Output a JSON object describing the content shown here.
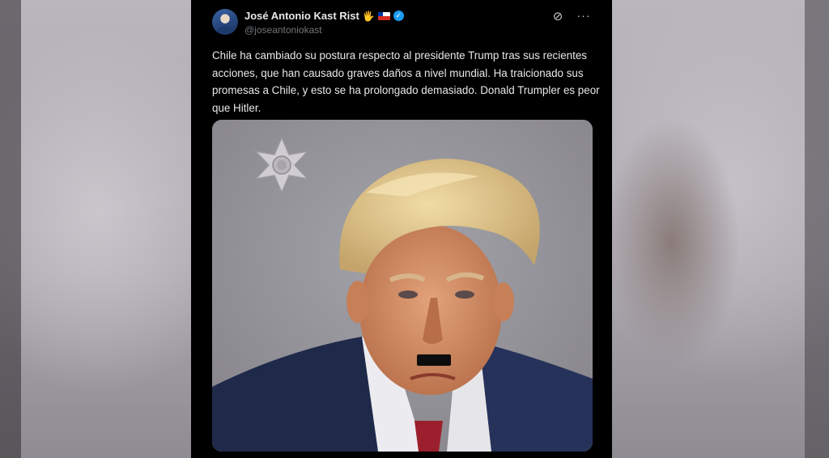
{
  "tweet": {
    "author_name": "José Antonio Kast Rist",
    "emoji_hand": "🖐",
    "verified_mark": "✓",
    "handle": "@joseantoniokast",
    "text": "Chile ha cambiado su postura respecto al presidente Trump tras sus recientes acciones, que han causado graves daños a nivel mundial. Ha traicionado sus promesas a Chile, y esto se ha prolongado demasiado. Donald Trumpler es peor que Hitler.",
    "grok_icon_glyph": "⊘",
    "more_icon_glyph": "···"
  },
  "icons": [
    "avatar",
    "raised-hand-emoji",
    "chile-flag-icon",
    "verified-badge-icon",
    "grok-icon",
    "more-icon"
  ],
  "colors": {
    "tweet_background": "#000000",
    "text_primary": "#e7e9ea",
    "text_secondary": "#71767b",
    "verified_blue": "#1d9bf0"
  }
}
